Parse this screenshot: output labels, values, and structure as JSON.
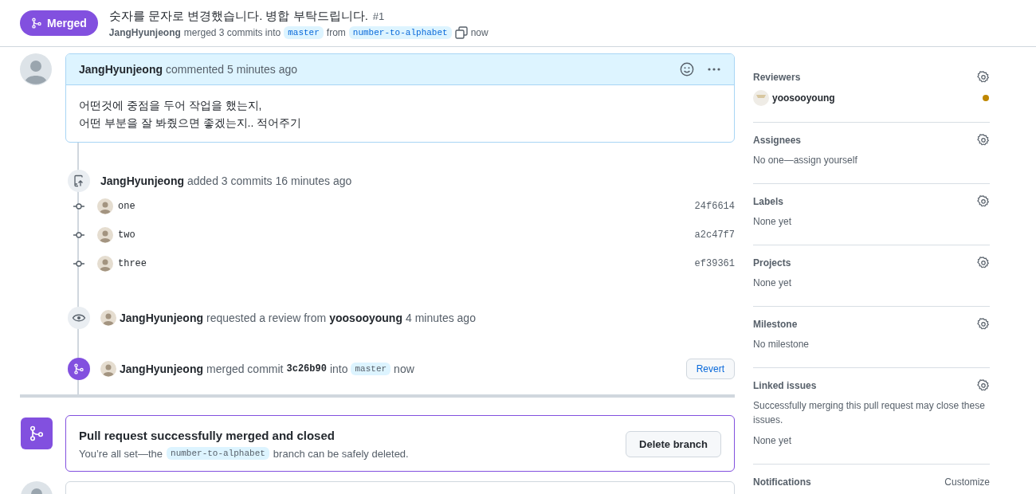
{
  "header": {
    "state": "Merged",
    "title": "숫자를 문자로 변경했습니다. 병합 부탁드립니다.",
    "number": "#1",
    "author": "JangHyunjeong",
    "action": "merged 3 commits into",
    "base_branch": "master",
    "from_text": "from",
    "head_branch": "number-to-alphabet",
    "time": "now"
  },
  "comment": {
    "author": "JangHyunjeong",
    "meta": "commented 5 minutes ago",
    "lines": [
      "어떤것에 중점을 두어 작업을 했는지,",
      "어떤 부분을 잘 봐줬으면 좋겠는지.. 적어주기"
    ]
  },
  "timeline": [
    {
      "kind": "commits",
      "author": "JangHyunjeong",
      "text": "added 3 commits 16 minutes ago",
      "commits": [
        {
          "message": "one",
          "sha": "24f6614"
        },
        {
          "message": "two",
          "sha": "a2c47f7"
        },
        {
          "message": "three",
          "sha": "ef39361"
        }
      ]
    },
    {
      "kind": "review",
      "author": "JangHyunjeong",
      "text": "requested a review from",
      "reviewer": "yoosooyoung",
      "time": "4 minutes ago"
    },
    {
      "kind": "merge",
      "author": "JangHyunjeong",
      "text": "merged commit",
      "sha": "3c26b90",
      "into": "into",
      "branch": "master",
      "time": "now",
      "button": "Revert"
    }
  ],
  "merge_box": {
    "title": "Pull request successfully merged and closed",
    "before": "You’re all set—the",
    "branch": "number-to-alphabet",
    "after": "branch can be safely deleted.",
    "button": "Delete branch"
  },
  "sidebar": [
    {
      "title": "Reviewers",
      "has_gear": true,
      "reviewers": [
        {
          "name": "yoosooyoung",
          "color": "#bf8700"
        }
      ]
    },
    {
      "title": "Assignees",
      "has_gear": true,
      "lines": [
        "No one—assign yourself"
      ]
    },
    {
      "title": "Labels",
      "has_gear": true,
      "lines": [
        "None yet"
      ]
    },
    {
      "title": "Projects",
      "has_gear": true,
      "lines": [
        "None yet"
      ]
    },
    {
      "title": "Milestone",
      "has_gear": true,
      "lines": [
        "No milestone"
      ]
    },
    {
      "title": "Linked issues",
      "has_gear": true,
      "lines": [
        "Successfully merging this pull request may close these issues.",
        "None yet"
      ]
    },
    {
      "title": "Notifications",
      "has_gear": false,
      "action": "Customize"
    }
  ]
}
